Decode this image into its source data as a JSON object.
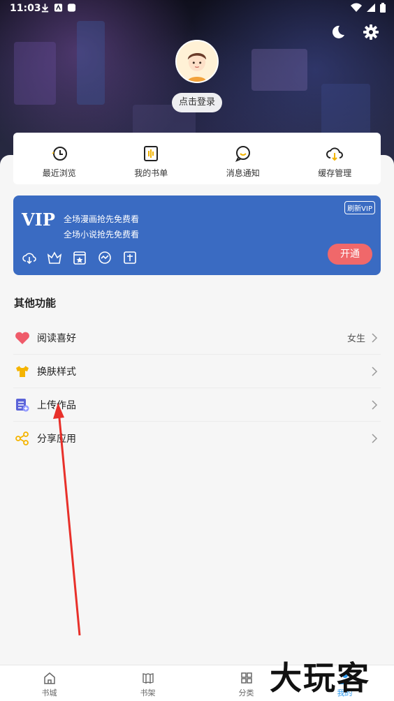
{
  "status_bar": {
    "time": "11:03"
  },
  "header": {
    "login_label": "点击登录"
  },
  "quick_actions": [
    {
      "label": "最近浏览",
      "icon": "history-icon"
    },
    {
      "label": "我的书单",
      "icon": "booklist-icon"
    },
    {
      "label": "消息通知",
      "icon": "message-icon"
    },
    {
      "label": "缓存管理",
      "icon": "cloud-download-icon"
    }
  ],
  "vip": {
    "title": "VIP",
    "line1": "全场漫画抢先免费看",
    "line2": "全场小说抢先免费看",
    "refresh_label": "刷新VIP",
    "open_label": "开通",
    "color": "#3a6bc2"
  },
  "other": {
    "section_title": "其他功能",
    "items": [
      {
        "label": "阅读喜好",
        "value": "女生",
        "icon": "heart-icon"
      },
      {
        "label": "换肤样式",
        "value": "",
        "icon": "tshirt-icon"
      },
      {
        "label": "上传作品",
        "value": "",
        "icon": "upload-doc-icon"
      },
      {
        "label": "分享应用",
        "value": "",
        "icon": "share-icon"
      }
    ]
  },
  "bottom_nav": [
    {
      "label": "书城",
      "icon": "home-icon"
    },
    {
      "label": "书架",
      "icon": "bookshelf-icon"
    },
    {
      "label": "分类",
      "icon": "grid-icon"
    },
    {
      "label": "我的",
      "icon": "profile-icon",
      "active": true
    }
  ],
  "watermark": "大玩客"
}
